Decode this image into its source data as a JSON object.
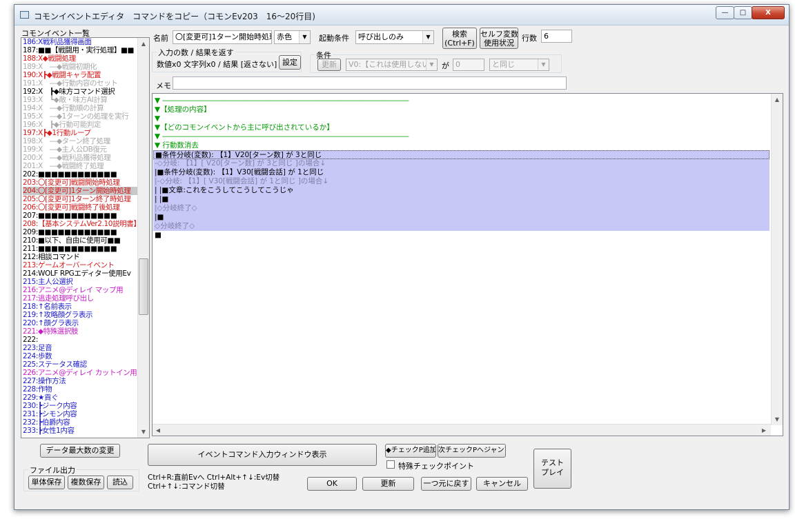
{
  "window": {
    "title": "コモンイベントエディタ　コマンドをコピー（コモンEv203　16～20行目)",
    "controls": {
      "minimize": "—",
      "maximize": "□",
      "close": "X"
    }
  },
  "left_panel": {
    "header": "コモンイベント一覧",
    "rows": [
      {
        "text": "186:X戦利品獲得画面",
        "color": "blue"
      },
      {
        "text": "187:■■【戦闘用・実行処理】■■",
        "color": "black"
      },
      {
        "text": "188:X◆戦闘処理",
        "color": "red"
      },
      {
        "text": "189:X　―◆戦闘初期化",
        "color": "gray"
      },
      {
        "text": "190:X┣◆戦闘キャラ配置",
        "color": "red"
      },
      {
        "text": "191:X　―◆行動内容のセット",
        "color": "gray"
      },
      {
        "text": "192:X　┣◆味方コマンド選択",
        "color": "black"
      },
      {
        "text": "193:X　┗◆敵・味方AI計算",
        "color": "gray"
      },
      {
        "text": "194:X　―◆行動順の計算",
        "color": "gray"
      },
      {
        "text": "195:X　―◆1ターンの処理を実行",
        "color": "gray"
      },
      {
        "text": "196:X　┣◆行動可能判定",
        "color": "gray"
      },
      {
        "text": "197:X┣◆1行動ループ",
        "color": "red"
      },
      {
        "text": "198:X　―◆ターン終了処理",
        "color": "gray"
      },
      {
        "text": "199:X　―◆主人公DB復元",
        "color": "gray"
      },
      {
        "text": "200:X　―◆戦利品獲得処理",
        "color": "gray"
      },
      {
        "text": "201:X　―◆戦闘終了処理",
        "color": "gray"
      },
      {
        "text": "202:■■■■■■■■■■■■",
        "color": "black"
      },
      {
        "text": "203:〇[変更可]戦闘開始時処理",
        "color": "red"
      },
      {
        "text": "204:〇[変更可]1ターン開始時処理",
        "color": "red",
        "selected": true
      },
      {
        "text": "205:〇[変更可]1ターン終了時処理",
        "color": "red"
      },
      {
        "text": "206:〇[変更可]戦闘終了後処理",
        "color": "red"
      },
      {
        "text": "207:■■■■■■■■■■■■",
        "color": "black"
      },
      {
        "text": "208:【基本システムVer2.10説明書】",
        "color": "red"
      },
      {
        "text": "209:■■■■■■■■■■■■",
        "color": "black"
      },
      {
        "text": "210:■以下、自由に使用可■■",
        "color": "black"
      },
      {
        "text": "211:■■■■■■■■■■■■",
        "color": "black"
      },
      {
        "text": "212:相談コマンド",
        "color": "black"
      },
      {
        "text": "213:ゲームオーバーイベント",
        "color": "red"
      },
      {
        "text": "214:WOLF RPGエディター使用Ev",
        "color": "black"
      },
      {
        "text": "215:主人公選択",
        "color": "blue"
      },
      {
        "text": "216:アニメ@ディレイ マップ用",
        "color": "magenta"
      },
      {
        "text": "217:逃走処理呼び出し",
        "color": "magenta"
      },
      {
        "text": "218:↑名前表示",
        "color": "blue"
      },
      {
        "text": "219:↑攻略顔グラ表示",
        "color": "blue"
      },
      {
        "text": "220:↑顔グラ表示",
        "color": "blue"
      },
      {
        "text": "221:◆特殊選択肢",
        "color": "magenta"
      },
      {
        "text": "222:",
        "color": "black"
      },
      {
        "text": "223:足音",
        "color": "blue"
      },
      {
        "text": "224:歩数",
        "color": "blue"
      },
      {
        "text": "225:ステータス確認",
        "color": "blue"
      },
      {
        "text": "226:アニメ@ディレイ カットイン用",
        "color": "magenta"
      },
      {
        "text": "227:操作方法",
        "color": "blue"
      },
      {
        "text": "228:作物",
        "color": "blue"
      },
      {
        "text": "229:★貢ぐ",
        "color": "blue"
      },
      {
        "text": "230:┣ジーク内容",
        "color": "blue"
      },
      {
        "text": "231:┣シモン内容",
        "color": "blue"
      },
      {
        "text": "232:┣伯爵内容",
        "color": "blue"
      },
      {
        "text": "233:┣女性1内容",
        "color": "blue"
      }
    ],
    "scroll_position": 0.65
  },
  "top_form": {
    "name_label": "名前",
    "name_value": "〇[変更可]1ターン開始時処理",
    "color_value": "赤色",
    "trigger_label": "起動条件",
    "trigger_value": "呼び出しのみ",
    "search_button": [
      "検索",
      "(Ctrl+F)"
    ],
    "self_var_button": [
      "セルフ変数",
      "使用状況"
    ],
    "rows_label": "行数",
    "rows_value": "6",
    "io_group_title": "入力の数 / 結果を返す",
    "io_text": "数値x0 文字列x0 / 結果 [返さない]",
    "io_set_button": "設定",
    "cond_group_title": "条件",
    "cond_update_button": "更新",
    "cond_var_value": "V0:【これは使用しない】",
    "cond_ga": "が",
    "cond_num_value": "0",
    "cond_compare_value": "と同じ",
    "memo_label": "メモ",
    "memo_value": ""
  },
  "code_lines": [
    {
      "text": "▼ ――――――――――――――――――――――――――――――――――",
      "style": "green"
    },
    {
      "text": "▼【処理の内容】",
      "style": "green"
    },
    {
      "text": "▼",
      "style": "green"
    },
    {
      "text": "▼【どのコモンイベントから主に呼び出されているか】",
      "style": "green"
    },
    {
      "text": "▼ ――――――――――――――――――――――――――――――――――",
      "style": "green"
    },
    {
      "text": "▼ 行動数消去",
      "style": "green"
    },
    {
      "text": "■条件分岐(変数): 【1】V20[ターン数] が 3と同じ",
      "style": "hl-first"
    },
    {
      "text": "-◇分岐: 【1】[ V20[ターン数] が 3と同じ ]の場合↓",
      "style": "hl-dim"
    },
    {
      "text": " |■条件分岐(変数): 【1】V30[戦闘会話] が 1と同じ",
      "style": "hl"
    },
    {
      "text": " |-◇分岐: 【1】[ V30[戦闘会話] が 1と同じ ]の場合↓",
      "style": "hl-dim"
    },
    {
      "text": " | |■文章:これをこうしてこうしてこうじゃ",
      "style": "hl"
    },
    {
      "text": " | |■",
      "style": "hl"
    },
    {
      "text": " |◇分岐終了◇",
      "style": "hl-dim"
    },
    {
      "text": " |■",
      "style": "hl"
    },
    {
      "text": "◇分岐終了◇",
      "style": "hl-dim"
    },
    {
      "text": "■",
      "style": "plain"
    }
  ],
  "bottom": {
    "data_max_button": "データ最大数の変更",
    "event_cmd_button": "イベントコマンド入力ウィンドウ表示",
    "add_check_button": "◆チェックP追加",
    "next_check_button": "次チェックPへジャンプ",
    "special_check_label": "特殊チェックポイント",
    "test_play_button": [
      "テスト",
      "プレイ"
    ],
    "file_output_title": "ファイル出力",
    "single_save_button": "単体保存",
    "multi_save_button": "複数保存",
    "load_button": "読込",
    "hint_line1": "Ctrl+R:直前Evへ  Ctrl+Alt+↑↓:Ev切替",
    "hint_line2": "Ctrl+↑↓:コマンド切替",
    "ok_button": "OK",
    "update_button": "更新",
    "undo_button": "一つ元に戻す",
    "cancel_button": "キャンセル"
  },
  "colors": {
    "black": "#000000",
    "blue": "#1a1ac8",
    "red": "#d21a1a",
    "gray": "#a8a8a8",
    "magenta": "#c81ac8",
    "highlight": "#c8c8f8",
    "comment_green": "#009a00"
  }
}
